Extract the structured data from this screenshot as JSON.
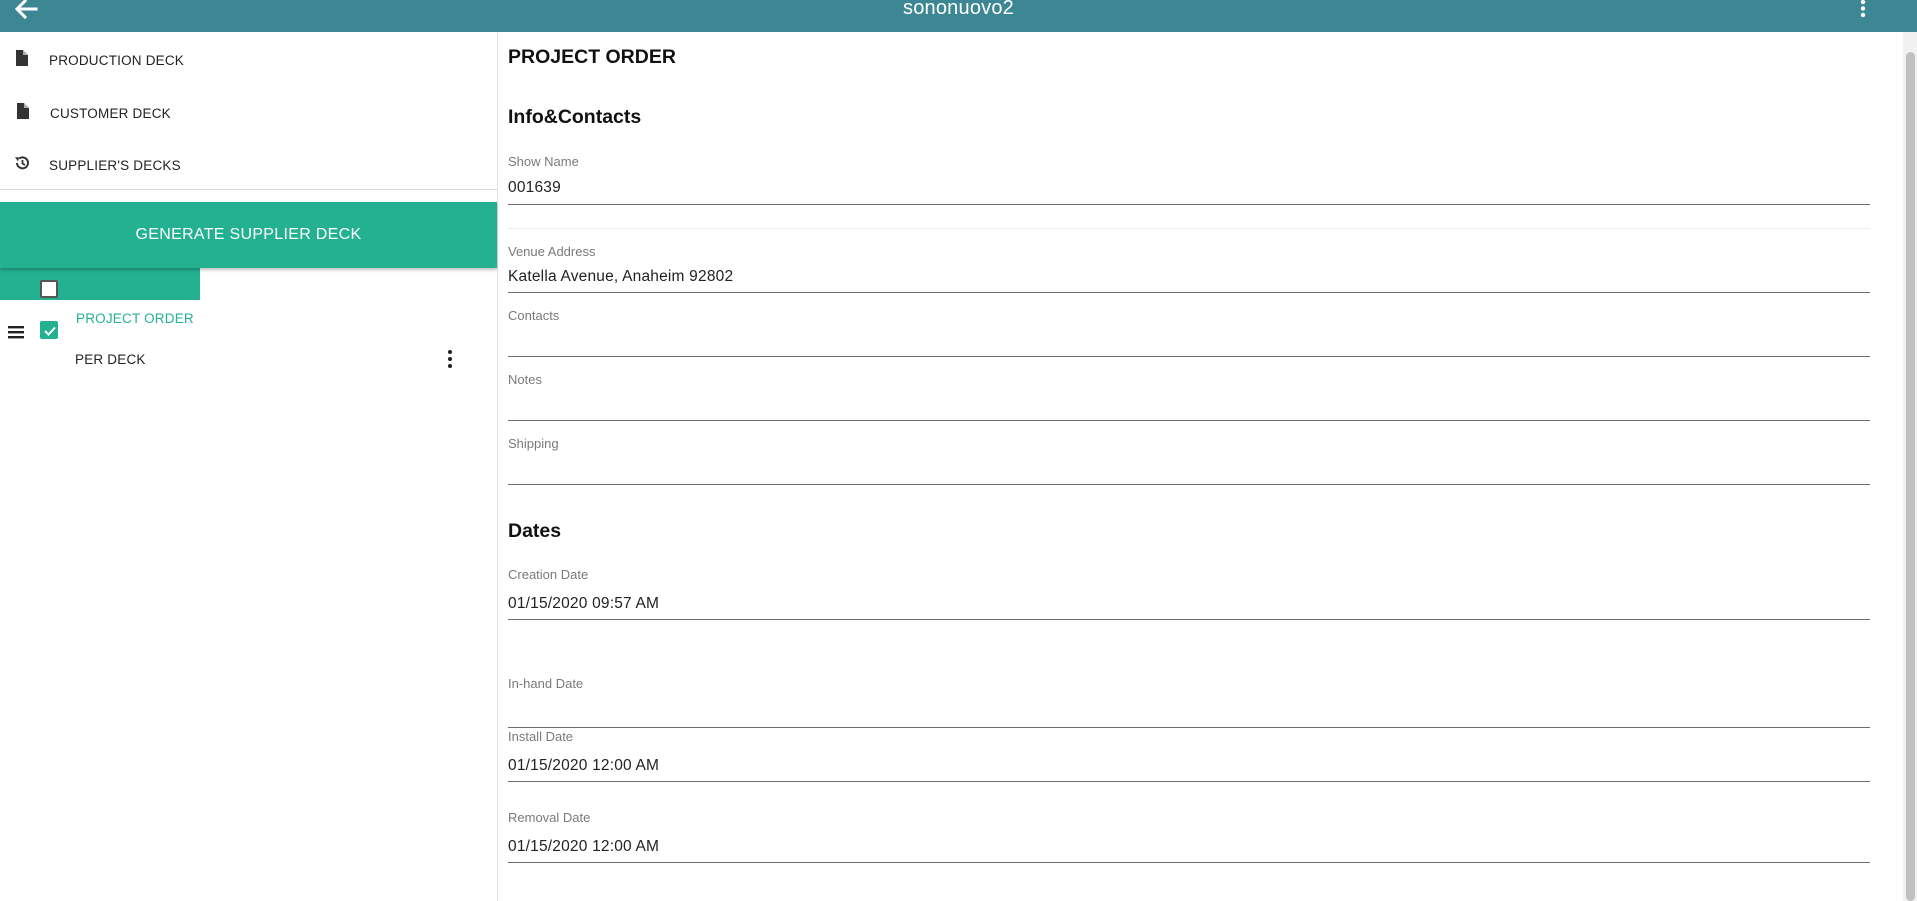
{
  "topbar": {
    "title": "sononuovo2",
    "back_icon": "arrow-left-icon",
    "more_icon": "more-vertical-icon",
    "color": "#3d8795"
  },
  "sidebar": {
    "menu": [
      {
        "label": "PRODUCTION DECK",
        "icon": "file-icon"
      },
      {
        "label": "CUSTOMER DECK",
        "icon": "file-icon"
      },
      {
        "label": "SUPPLIER'S DECKS",
        "icon": "history-icon"
      }
    ],
    "generate_button": "GENERATE SUPPLIER DECK",
    "tree": [
      {
        "label": "PROJECT ORDER",
        "icon": "home-icon",
        "checked": false,
        "active": true
      },
      {
        "label": "PER DECK",
        "icon": "menu-icon",
        "checked": true,
        "active": false
      }
    ],
    "accent": "#23b191"
  },
  "main": {
    "page_title": "PROJECT ORDER",
    "sections": {
      "info": "Info&Contacts",
      "dates": "Dates"
    },
    "fields": {
      "show_name": {
        "label": "Show Name",
        "value": "001639"
      },
      "venue_address": {
        "label": "Venue Address",
        "value": "Katella Avenue, Anaheim 92802"
      },
      "contacts": {
        "label": "Contacts",
        "value": ""
      },
      "notes": {
        "label": "Notes",
        "value": ""
      },
      "shipping": {
        "label": "Shipping",
        "value": ""
      },
      "creation_date": {
        "label": "Creation Date",
        "value": "01/15/2020 09:57 AM"
      },
      "inhand_date": {
        "label": "In-hand Date",
        "value": ""
      },
      "install_date": {
        "label": "Install Date",
        "value": "01/15/2020 12:00 AM"
      },
      "removal_date": {
        "label": "Removal Date",
        "value": "01/15/2020 12:00 AM"
      }
    }
  }
}
